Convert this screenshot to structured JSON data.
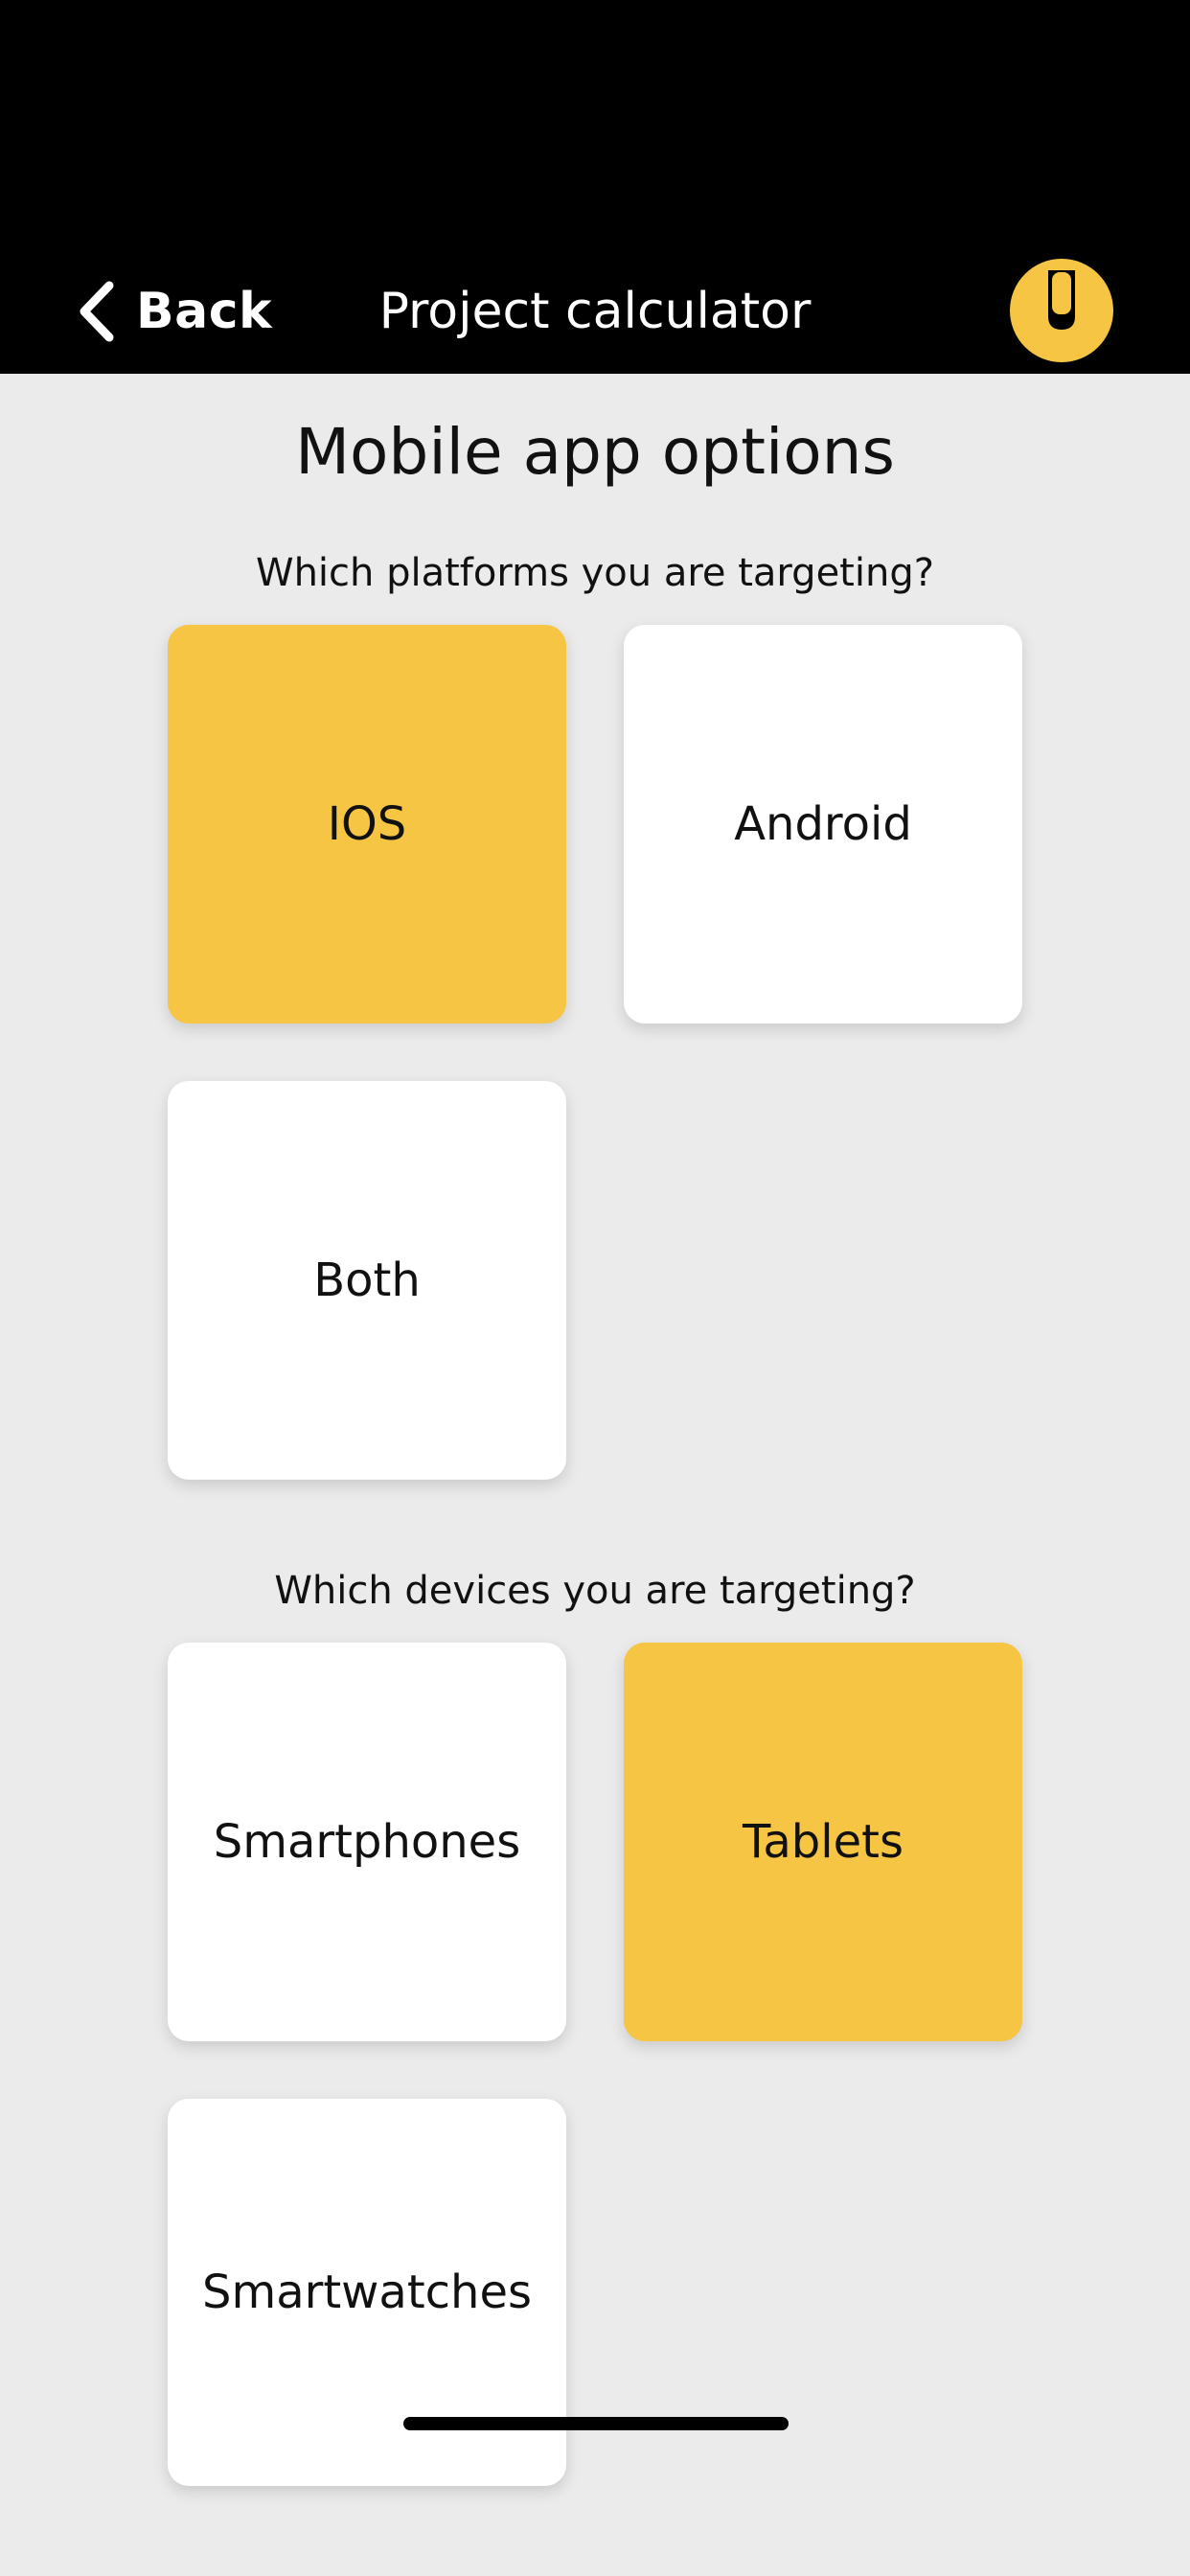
{
  "header": {
    "back_label": "Back",
    "title": "Project calculator",
    "logo_icon": "u-logo-icon",
    "back_icon": "chevron-left-icon"
  },
  "main": {
    "title": "Mobile app options",
    "platforms": {
      "question": "Which platforms you are targeting?",
      "options": [
        {
          "label": "IOS",
          "selected": true
        },
        {
          "label": "Android",
          "selected": false
        },
        {
          "label": "Both",
          "selected": false
        }
      ]
    },
    "devices": {
      "question": "Which devices you are targeting?",
      "options": [
        {
          "label": "Smartphones",
          "selected": false
        },
        {
          "label": "Tablets",
          "selected": true
        },
        {
          "label": "Smartwatches",
          "selected": false
        }
      ]
    }
  },
  "colors": {
    "accent": "#f5c543",
    "background": "#ebebeb",
    "header": "#000000",
    "tile": "#ffffff"
  }
}
